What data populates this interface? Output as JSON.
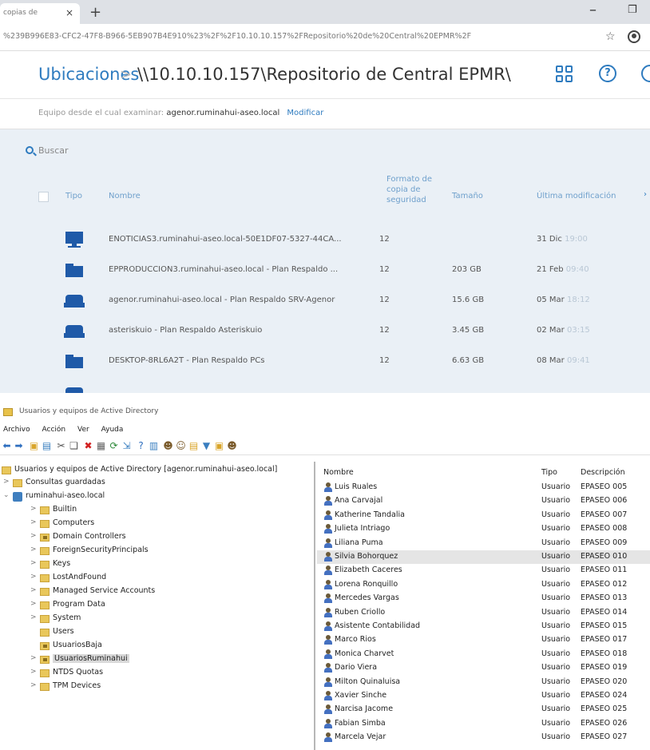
{
  "browser": {
    "tab_title": "copias de",
    "tab_close": "×",
    "new_tab": "+",
    "url": "%239B996E83-CFC2-47F8-B966-5EB907B4E910%23%2F%2F10.10.10.157%2FRepositorio%20de%20Central%20EPMR%2F"
  },
  "backup": {
    "breadcrumb_root": "Ubicaciones",
    "breadcrumb_sep": ">",
    "breadcrumb_path": "\\\\10.10.10.157\\Repositorio de Central EPMR\\",
    "help_label": "?",
    "machine_label": "Equipo desde el cual examinar:",
    "machine_value": "agenor.ruminahui-aseo.local",
    "modify_label": "Modificar",
    "search_label": "Buscar",
    "columns": {
      "tipo": "Tipo",
      "nombre": "Nombre",
      "formato": "Formato de copia de seguridad",
      "tamano": "Tamaño",
      "ultima": "Última modificación"
    },
    "rows": [
      {
        "icon": "monitor",
        "name": "ENOTICIAS3.ruminahui-aseo.local-50E1DF07-5327-44CA...",
        "format": "12",
        "size": "",
        "date": "31 Dic",
        "time": "19:00"
      },
      {
        "icon": "folder",
        "name": "EPPRODUCCION3.ruminahui-aseo.local - Plan Respaldo ...",
        "format": "12",
        "size": "203 GB",
        "date": "21 Feb",
        "time": "09:40"
      },
      {
        "icon": "server",
        "name": "agenor.ruminahui-aseo.local - Plan Respaldo SRV-Agenor",
        "format": "12",
        "size": "15.6 GB",
        "date": "05 Mar",
        "time": "18:12"
      },
      {
        "icon": "server",
        "name": "asteriskuio - Plan Respaldo Asteriskuio",
        "format": "12",
        "size": "3.45 GB",
        "date": "02 Mar",
        "time": "03:15"
      },
      {
        "icon": "folder",
        "name": "DESKTOP-8RL6A2T - Plan Respaldo PCs",
        "format": "12",
        "size": "6.63 GB",
        "date": "08 Mar",
        "time": "09:41"
      }
    ]
  },
  "ad": {
    "window_title": "Usuarios y equipos de Active Directory",
    "menu": [
      "Archivo",
      "Acción",
      "Ver",
      "Ayuda"
    ],
    "tree": {
      "root": "Usuarios y equipos de Active Directory [agenor.ruminahui-aseo.local]",
      "saved_queries": "Consultas guardadas",
      "domain": "ruminahui-aseo.local",
      "nodes": [
        {
          "label": "Builtin",
          "ou": false,
          "expandable": true
        },
        {
          "label": "Computers",
          "ou": false,
          "expandable": true
        },
        {
          "label": "Domain Controllers",
          "ou": true,
          "expandable": true
        },
        {
          "label": "ForeignSecurityPrincipals",
          "ou": false,
          "expandable": true
        },
        {
          "label": "Keys",
          "ou": false,
          "expandable": true
        },
        {
          "label": "LostAndFound",
          "ou": false,
          "expandable": true
        },
        {
          "label": "Managed Service Accounts",
          "ou": false,
          "expandable": true
        },
        {
          "label": "Program Data",
          "ou": false,
          "expandable": true
        },
        {
          "label": "System",
          "ou": false,
          "expandable": true
        },
        {
          "label": "Users",
          "ou": false,
          "expandable": false
        },
        {
          "label": "UsuariosBaja",
          "ou": true,
          "expandable": false
        },
        {
          "label": "UsuariosRuminahui",
          "ou": true,
          "expandable": true,
          "selected": true
        },
        {
          "label": "NTDS Quotas",
          "ou": false,
          "expandable": true
        },
        {
          "label": "TPM Devices",
          "ou": false,
          "expandable": true
        }
      ]
    },
    "list": {
      "col_name": "Nombre",
      "col_type": "Tipo",
      "col_desc": "Descripción",
      "rows": [
        {
          "name": "Luis Ruales",
          "type": "Usuario",
          "desc": "EPASEO 005"
        },
        {
          "name": "Ana Carvajal",
          "type": "Usuario",
          "desc": "EPASEO 006"
        },
        {
          "name": "Katherine Tandalia",
          "type": "Usuario",
          "desc": "EPASEO 007"
        },
        {
          "name": "Julieta Intriago",
          "type": "Usuario",
          "desc": "EPASEO 008"
        },
        {
          "name": "Liliana Puma",
          "type": "Usuario",
          "desc": "EPASEO 009"
        },
        {
          "name": "Silvia Bohorquez",
          "type": "Usuario",
          "desc": "EPASEO 010",
          "selected": true
        },
        {
          "name": "Elizabeth Caceres",
          "type": "Usuario",
          "desc": "EPASEO 011"
        },
        {
          "name": "Lorena Ronquillo",
          "type": "Usuario",
          "desc": "EPASEO 012"
        },
        {
          "name": "Mercedes Vargas",
          "type": "Usuario",
          "desc": "EPASEO 013"
        },
        {
          "name": "Ruben Criollo",
          "type": "Usuario",
          "desc": "EPASEO 014"
        },
        {
          "name": "Asistente Contabilidad",
          "type": "Usuario",
          "desc": "EPASEO 015"
        },
        {
          "name": "Marco Rios",
          "type": "Usuario",
          "desc": "EPASEO 017"
        },
        {
          "name": "Monica Charvet",
          "type": "Usuario",
          "desc": "EPASEO 018"
        },
        {
          "name": "Dario Viera",
          "type": "Usuario",
          "desc": "EPASEO 019"
        },
        {
          "name": "Milton Quinaluisa",
          "type": "Usuario",
          "desc": "EPASEO 020"
        },
        {
          "name": "Xavier Sinche",
          "type": "Usuario",
          "desc": "EPASEO 024"
        },
        {
          "name": "Narcisa Jacome",
          "type": "Usuario",
          "desc": "EPASEO 025"
        },
        {
          "name": "Fabian Simba",
          "type": "Usuario",
          "desc": "EPASEO 026"
        },
        {
          "name": "Marcela Vejar",
          "type": "Usuario",
          "desc": "EPASEO 027"
        }
      ]
    }
  },
  "colors": {
    "accent_blue": "#2e7bbf",
    "icon_blue": "#1f5aa8",
    "list_bg": "#eaf0f6",
    "folder_yellow": "#e9c75a"
  }
}
